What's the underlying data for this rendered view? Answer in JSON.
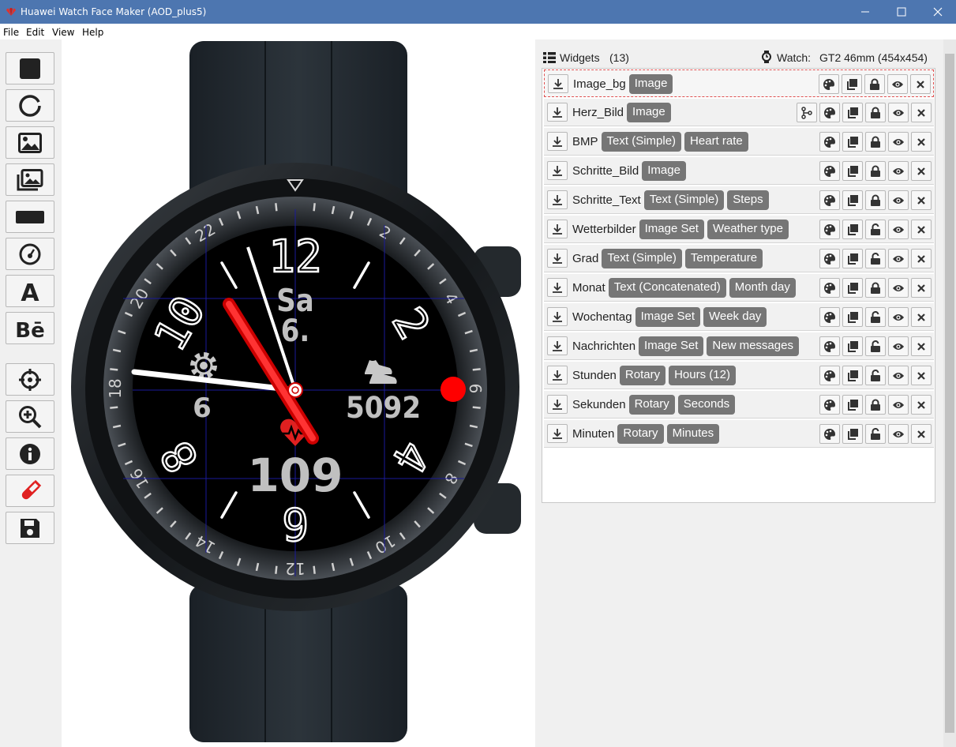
{
  "window": {
    "title": "Huawei Watch Face Maker (AOD_plus5)",
    "controls": [
      "minimize-icon",
      "maximize-icon",
      "close-icon"
    ]
  },
  "menu": [
    "File",
    "Edit",
    "View",
    "Help"
  ],
  "toolbar": {
    "tools": [
      "square-icon",
      "circle-icon",
      "image-icon",
      "images-icon",
      "rectangle-icon",
      "gauge-icon",
      "text-icon",
      "behance-icon",
      "crosshair-icon",
      "zoom-in-icon",
      "info-icon",
      "test-tube-icon",
      "save-icon"
    ],
    "active_color": "#e02020"
  },
  "watch": {
    "bezel_numbers": [
      "2",
      "4",
      "6",
      "8",
      "10",
      "12",
      "14",
      "16",
      "18",
      "20",
      "22"
    ],
    "dial_numbers": [
      "12",
      "2",
      "4",
      "6",
      "8",
      "10"
    ],
    "day": "Sa",
    "date": "6.",
    "left_value": "6",
    "steps": "5092",
    "heart_rate": "109"
  },
  "panel": {
    "title": "Widgets",
    "count": "(13)",
    "watch_label": "Watch:",
    "watch_model": "GT2 46mm (454x454)"
  },
  "widgets": [
    {
      "name": "Image_bg",
      "tags": [
        "Image"
      ],
      "locked": true,
      "extra": false,
      "selected": true
    },
    {
      "name": "Herz_Bild",
      "tags": [
        "Image"
      ],
      "locked": true,
      "extra": true
    },
    {
      "name": "BMP",
      "tags": [
        "Text (Simple)",
        "Heart rate"
      ],
      "locked": true
    },
    {
      "name": "Schritte_Bild",
      "tags": [
        "Image"
      ],
      "locked": true
    },
    {
      "name": "Schritte_Text",
      "tags": [
        "Text (Simple)",
        "Steps"
      ],
      "locked": true
    },
    {
      "name": "Wetterbilder",
      "tags": [
        "Image Set",
        "Weather type"
      ],
      "locked": false
    },
    {
      "name": "Grad",
      "tags": [
        "Text (Simple)",
        "Temperature"
      ],
      "locked": false
    },
    {
      "name": "Monat",
      "tags": [
        "Text (Concatenated)",
        "Month day"
      ],
      "locked": true
    },
    {
      "name": "Wochentag",
      "tags": [
        "Image Set",
        "Week day"
      ],
      "locked": false
    },
    {
      "name": "Nachrichten",
      "tags": [
        "Image Set",
        "New messages"
      ],
      "locked": false
    },
    {
      "name": "Stunden",
      "tags": [
        "Rotary",
        "Hours (12)"
      ],
      "locked": false
    },
    {
      "name": "Sekunden",
      "tags": [
        "Rotary",
        "Seconds"
      ],
      "locked": true
    },
    {
      "name": "Minuten",
      "tags": [
        "Rotary",
        "Minutes"
      ],
      "locked": false
    }
  ]
}
